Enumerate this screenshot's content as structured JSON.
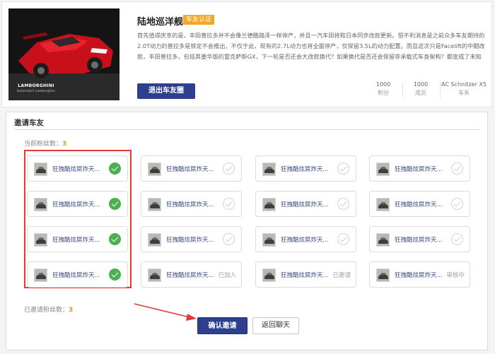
{
  "club": {
    "name": "陆地巡洋舰",
    "badge": "车友认证",
    "cover": {
      "brand": "LAMBORGHINI",
      "brand_sub": "Automobili Lamborghini"
    },
    "intro": "首先值得庆幸的是，丰田普拉多并不会像兰德酷路泽一样停产，并且一汽丰田将和日本同步改款更新。但不利消息是之前众多车友期待的2.0T动力的普拉多是铁定不会推出，不仅于此，现有的2.7L动力也将全面停产，仅保留3.5L的动力配置。而且这次只是Facelift的中期改款，丰田普拉多，包括其姜华版的雷克萨斯GX，下一轮是否还会大改款换代？如果换代是否还会保留非承载式车身架构？都变成了未知数。",
    "quit_label": "退出车友圈",
    "stats": [
      {
        "value": "1000",
        "label": "积分"
      },
      {
        "value": "1000",
        "label": "成员"
      },
      {
        "value": "AC Schnitzer X5",
        "label": "车系"
      }
    ]
  },
  "invite": {
    "title": "邀请车友",
    "fans_label": "当前粉丝数：",
    "fans_count": "3",
    "invited_label": "已邀请粉丝数：",
    "invited_count": "3",
    "confirm_label": "确认邀请",
    "back_label": "返回聊天",
    "users": [
      {
        "name": "狂拽酷炫屌炸天...",
        "state": "selected"
      },
      {
        "name": "狂拽酷炫屌炸天...",
        "state": "unselected"
      },
      {
        "name": "狂拽酷炫屌炸天...",
        "state": "unselected"
      },
      {
        "name": "狂拽酷炫屌炸天...",
        "state": "unselected"
      },
      {
        "name": "狂拽酷炫屌炸天...",
        "state": "selected"
      },
      {
        "name": "狂拽酷炫屌炸天...",
        "state": "unselected"
      },
      {
        "name": "狂拽酷炫屌炸天...",
        "state": "unselected"
      },
      {
        "name": "狂拽酷炫屌炸天...",
        "state": "unselected"
      },
      {
        "name": "狂拽酷炫屌炸天...",
        "state": "selected"
      },
      {
        "name": "狂拽酷炫屌炸天...",
        "state": "unselected"
      },
      {
        "name": "狂拽酷炫屌炸天...",
        "state": "unselected"
      },
      {
        "name": "狂拽酷炫屌炸天...",
        "state": "unselected"
      },
      {
        "name": "狂拽酷炫屌炸天...",
        "state": "selected"
      },
      {
        "name": "狂拽酷炫屌炸天...",
        "state": "joined",
        "status": "已加入"
      },
      {
        "name": "狂拽酷炫屌炸天...",
        "state": "invited",
        "status": "已邀请"
      },
      {
        "name": "狂拽酷炫屌炸天...",
        "state": "pending",
        "status": "审核中"
      }
    ]
  },
  "colors": {
    "primary": "#2e3f8f",
    "badge": "#f5a623",
    "check": "#4caf50",
    "highlight": "#e03a3a",
    "count": "#f08c1c"
  },
  "icons": [
    "check-icon",
    "avatar-car-icon",
    "arrow-pointer-icon"
  ]
}
